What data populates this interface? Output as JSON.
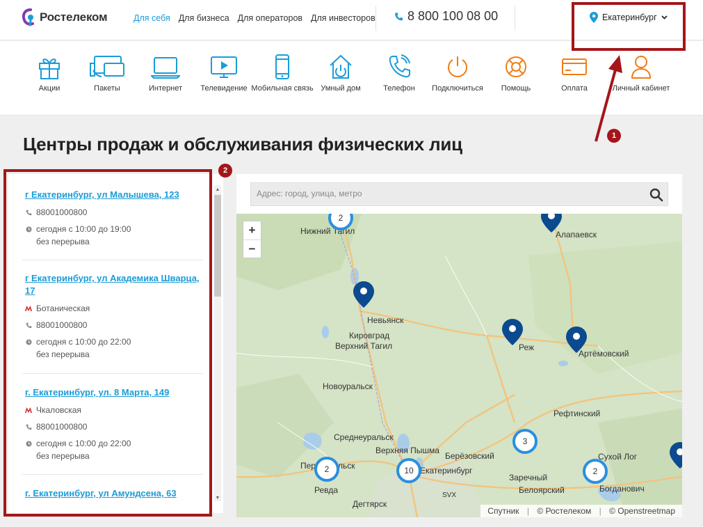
{
  "header": {
    "logo_text": "Ростелеком",
    "nav": [
      {
        "label": "Для себя",
        "active": true
      },
      {
        "label": "Для бизнеса",
        "active": false
      },
      {
        "label": "Для операторов",
        "active": false
      },
      {
        "label": "Для инвесторов",
        "active": false
      }
    ],
    "phone": "8 800 100 08 00",
    "city": "Екатеринбург"
  },
  "iconbar": [
    {
      "label": "Акции",
      "icon": "gift-icon"
    },
    {
      "label": "Пакеты",
      "icon": "devices-icon"
    },
    {
      "label": "Интернет",
      "icon": "laptop-icon"
    },
    {
      "label": "Телевидение",
      "icon": "tv-icon"
    },
    {
      "label": "Мобильная связь",
      "icon": "mobile-icon"
    },
    {
      "label": "Умный дом",
      "icon": "smart-home-icon"
    },
    {
      "label": "Телефон",
      "icon": "phone-handset-icon"
    },
    {
      "label": "Подключиться",
      "icon": "power-icon"
    },
    {
      "label": "Помощь",
      "icon": "lifebuoy-icon"
    },
    {
      "label": "Оплата",
      "icon": "card-icon"
    },
    {
      "label": "Личный кабинет",
      "icon": "user-icon"
    }
  ],
  "page_title": "Центры продаж и обслуживания физических лиц",
  "offices": [
    {
      "name": "г Екатеринбург, ул Малышева, 123",
      "metro": "",
      "phone": "88001000800",
      "hours": "сегодня с 10:00 до 19:00",
      "break": "без перерыва"
    },
    {
      "name": "г Екатеринбург, ул Академика Шварца, 17",
      "metro": "Ботаническая",
      "phone": "88001000800",
      "hours": "сегодня с 10:00 до 22:00",
      "break": "без перерыва"
    },
    {
      "name": "г. Екатеринбург, ул. 8 Марта, 149",
      "metro": "Чкаловская",
      "phone": "88001000800",
      "hours": "сегодня с 10:00 до 22:00",
      "break": "без перерыва"
    },
    {
      "name": "г. Екатеринбург, ул Амундсена, 63",
      "metro": "",
      "phone": "",
      "hours": "",
      "break": ""
    }
  ],
  "search": {
    "placeholder": "Адрес: город, улица, метро"
  },
  "map": {
    "zoom_in": "+",
    "zoom_out": "−",
    "attribution": [
      "Спутник",
      "© Ростелеком",
      "© Openstreetmap"
    ],
    "places": [
      "Нижний Тагил",
      "Алапаевск",
      "Невьянск",
      "Кировград",
      "Верхний Тагил",
      "Реж",
      "Артёмовский",
      "Новоуральск",
      "Рефтинский",
      "Среднеуральск",
      "Верхняя Пышма",
      "Берёзовский",
      "Первоуральск",
      "Ревда",
      "Екатеринбург",
      "Заречный",
      "Белоярский",
      "Сухой Лог",
      "Богданович",
      "Дегтярск",
      "SVX"
    ],
    "clusters": [
      "2",
      "3",
      "2",
      "10",
      "2"
    ]
  },
  "annotations": [
    "1",
    "2"
  ],
  "colors": {
    "accent": "#1a9cd8",
    "pin": "#0b4a8f",
    "annotation": "#a4161a",
    "map_bg": "#d8e6cc"
  }
}
